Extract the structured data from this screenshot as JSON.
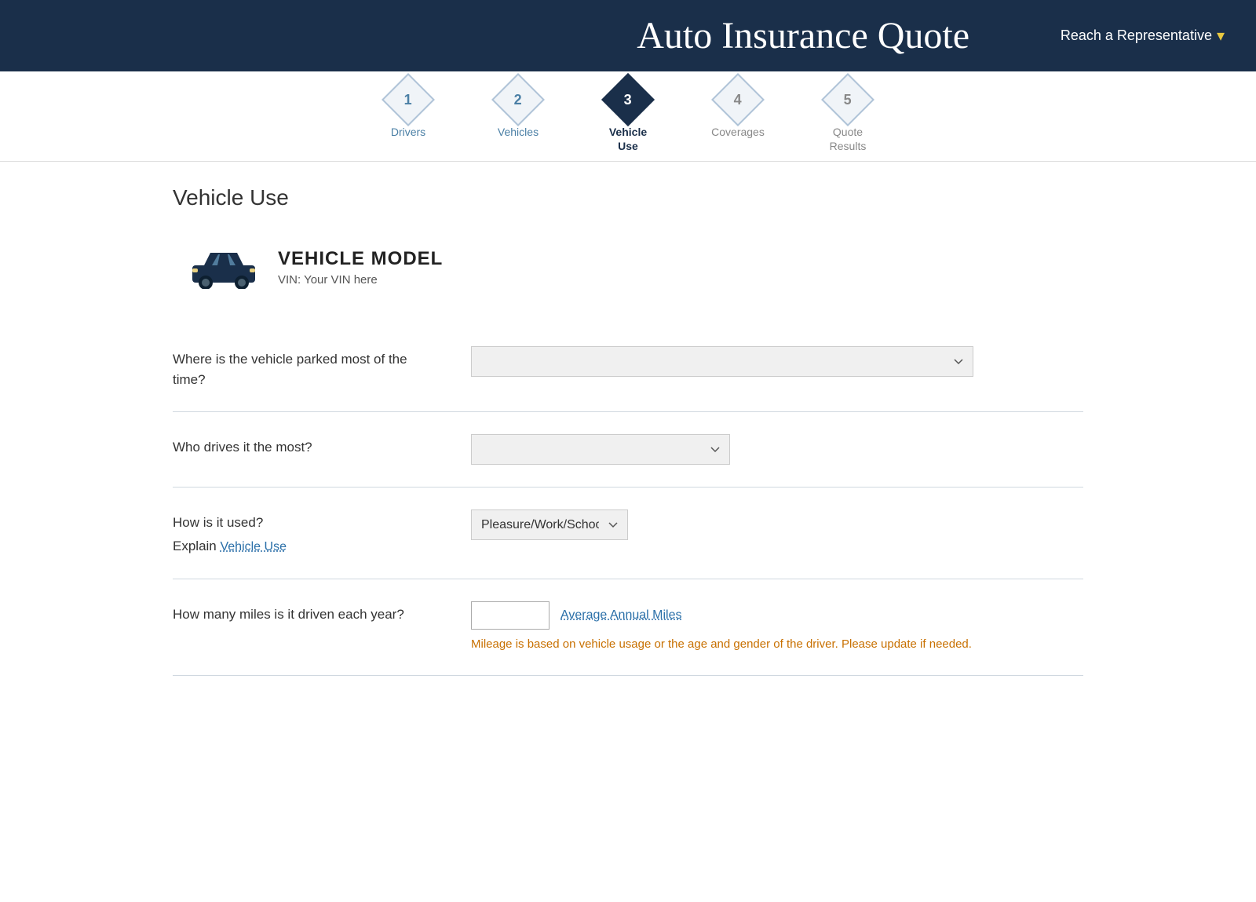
{
  "header": {
    "title": "Auto Insurance Quote",
    "reach_rep_label": "Reach a Representative",
    "chevron": "▾"
  },
  "steps": [
    {
      "number": "1",
      "label": "Drivers",
      "state": "completed"
    },
    {
      "number": "2",
      "label": "Vehicles",
      "state": "completed"
    },
    {
      "number": "3",
      "label": "Vehicle\nUse",
      "state": "active"
    },
    {
      "number": "4",
      "label": "Coverages",
      "state": "inactive"
    },
    {
      "number": "5",
      "label": "Quote\nResults",
      "state": "inactive"
    }
  ],
  "page": {
    "title": "Vehicle Use"
  },
  "vehicle": {
    "model": "VEHICLE MODEL",
    "vin_label": "VIN: Your VIN here"
  },
  "form": {
    "parking_question": "Where is the vehicle parked most of the time?",
    "parking_placeholder": "",
    "driver_question": "Who drives it the most?",
    "driver_placeholder": "",
    "usage_question": "How is it used?",
    "usage_explain_prefix": "Explain ",
    "usage_explain_link": "Vehicle Use",
    "usage_value": "Pleasure/Work/School",
    "mileage_question": "How many miles is it driven each year?",
    "mileage_value": "",
    "avg_annual_link": "Average Annual Miles",
    "mileage_note": "Mileage is based on vehicle usage or the age and gender of the driver. Please update if needed."
  }
}
